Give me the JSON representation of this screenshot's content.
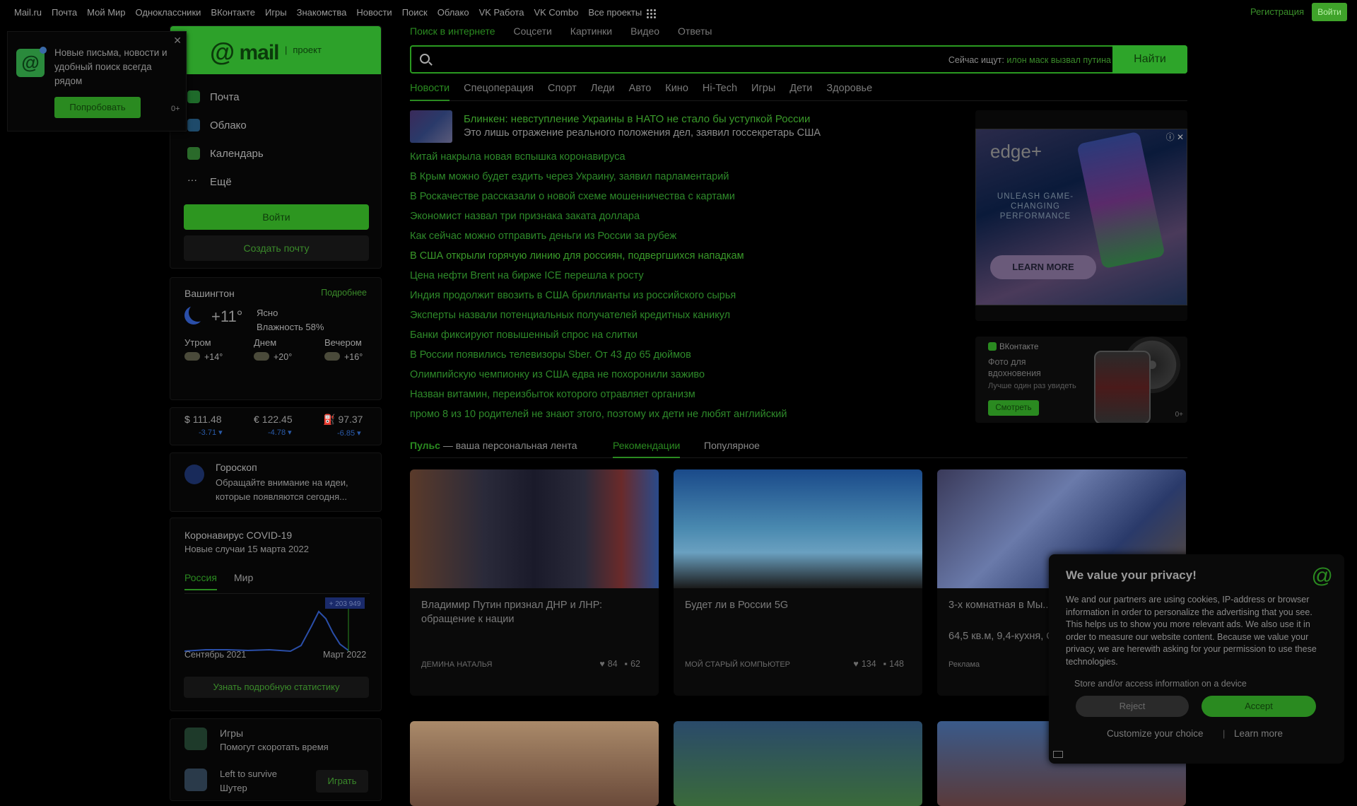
{
  "topnav": [
    "Mail.ru",
    "Почта",
    "Мой Мир",
    "Одноклассники",
    "ВКонтакте",
    "Игры",
    "Знакомства",
    "Новости",
    "Поиск",
    "Облако",
    "VK Работа",
    "VK Combo",
    "Все проекты"
  ],
  "auth": {
    "register": "Регистрация",
    "login": "Войти"
  },
  "notification": {
    "text": "Новые письма, новости и удобный поиск всегда рядом",
    "button": "Попробовать",
    "age": "0+"
  },
  "mail": {
    "logo": "mail",
    "project": "проект",
    "items": [
      "Почта",
      "Облако",
      "Календарь",
      "Ещё"
    ],
    "login": "Войти",
    "create": "Создать почту"
  },
  "weather": {
    "city": "Вашингтон",
    "more": "Подробнее",
    "temp": "+11°",
    "condition": "Ясно",
    "humidity": "Влажность 58%",
    "parts": [
      {
        "label": "Утром",
        "temp": "+14°"
      },
      {
        "label": "Днем",
        "temp": "+20°"
      },
      {
        "label": "Вечером",
        "temp": "+16°"
      }
    ]
  },
  "currency": [
    {
      "sym": "$",
      "value": "111.48",
      "delta": "-3.71 ▾"
    },
    {
      "sym": "€",
      "value": "122.45",
      "delta": "-4.78 ▾"
    },
    {
      "sym": "⛽",
      "value": "97.37",
      "delta": "-6.85 ▾"
    }
  ],
  "horoscope": {
    "title": "Гороскоп",
    "text": "Обращайте внимание на идеи, которые появляются сегодня..."
  },
  "covid": {
    "title": "Коронавирус COVID-19",
    "subtitle": "Новые случаи 15 марта 2022",
    "tabs": [
      "Россия",
      "Мир"
    ],
    "peak": "+ 203 949",
    "from": "Сентябрь 2021",
    "to": "Март 2022",
    "button": "Узнать подробную статистику"
  },
  "games": {
    "title": "Игры",
    "subtitle": "Помогут скоротать время",
    "game": "Left to survive",
    "genre": "Шутер",
    "play": "Играть"
  },
  "search": {
    "tabs": [
      "Поиск в интернете",
      "Соцсети",
      "Картинки",
      "Видео",
      "Ответы"
    ],
    "hint_label": "Сейчас ищут:",
    "hint_query": "илон маск вызвал путина",
    "button": "Найти"
  },
  "news_tabs": [
    "Новости",
    "Спецоперация",
    "Спорт",
    "Леди",
    "Авто",
    "Кино",
    "Hi-Tech",
    "Игры",
    "Дети",
    "Здоровье"
  ],
  "lead": {
    "title": "Блинкен: невступление Украины в НАТО не стало бы уступкой России",
    "subtitle": "Это лишь отражение реального положения дел, заявил госсекретарь США"
  },
  "news": [
    "Китай накрыла новая вспышка коронавируса",
    "В Крым можно будет ездить через Украину, заявил парламентарий",
    "В Роскачестве рассказали о новой схеме мошенничества с картами",
    "Экономист назвал три признака заката доллара",
    "Как сейчас можно отправить деньги из России за рубеж",
    "В США открыли горячую линию для россиян, подвергшихся нападкам",
    "Цена нефти Brent на бирже ICE перешла к росту",
    "Индия продолжит ввозить в США бриллианты из российского сырья",
    "Эксперты назвали потенциальных получателей кредитных каникул",
    "Банки фиксируют повышенный спрос на слитки",
    "В России появились телевизоры Sber. От 43 до 65 дюймов",
    "Олимпийскую чемпионку из США едва не похоронили заживо",
    "Назван витамин, переизбыток которого отравляет организм",
    "промо 8 из 10 родителей не знают этого, поэтому их дети не любят английский"
  ],
  "ad1": {
    "brand": "edge+",
    "tagline": "UNLEASH GAME-CHANGING PERFORMANCE",
    "cta": "LEARN MORE"
  },
  "ad2": {
    "source": "ВКонтакте",
    "title": "Фото для вдохновения",
    "sub": "Лучше один раз увидеть",
    "cta": "Смотреть",
    "age": "0+"
  },
  "pulse": {
    "brand": "Пульс",
    "tagline": " — ваша персональная лента",
    "tabs": [
      "Рекомендации",
      "Популярное"
    ]
  },
  "cards": [
    {
      "title": "Владимир Путин признал ДНР и ЛНР: обращение к нации",
      "source": "ДЕМИНА НАТАЛЬЯ",
      "likes": "84",
      "comments": "62"
    },
    {
      "title": "Будет ли в России 5G",
      "source": "МОЙ СТАРЫЙ КОМПЬЮТЕР",
      "likes": "134",
      "comments": "148"
    },
    {
      "title": "3-х комнатная в Мы... с мебелью и техни...",
      "extra": "64,5 кв.м, 9,4-кухня, Современный ЖК, 1...",
      "source": "Реклама",
      "likes": "",
      "comments": ""
    }
  ],
  "privacy": {
    "title": "We value your privacy!",
    "text": "We and our partners are using cookies, IP-address or browser information in order to personalize the advertising that you see. This helps us to show you more relevant ads. We also use it in order to measure our website content. Because we value your privacy, we are herewith asking for your permission to use these technologies.",
    "store": "Store and/or access information on a device",
    "reject": "Reject",
    "accept": "Accept",
    "customize": "Customize your choice",
    "sep": "|",
    "learn": "Learn more"
  },
  "colors": {
    "accent": "#2da12a",
    "background": "#000000",
    "link": "#2e8a2a"
  }
}
